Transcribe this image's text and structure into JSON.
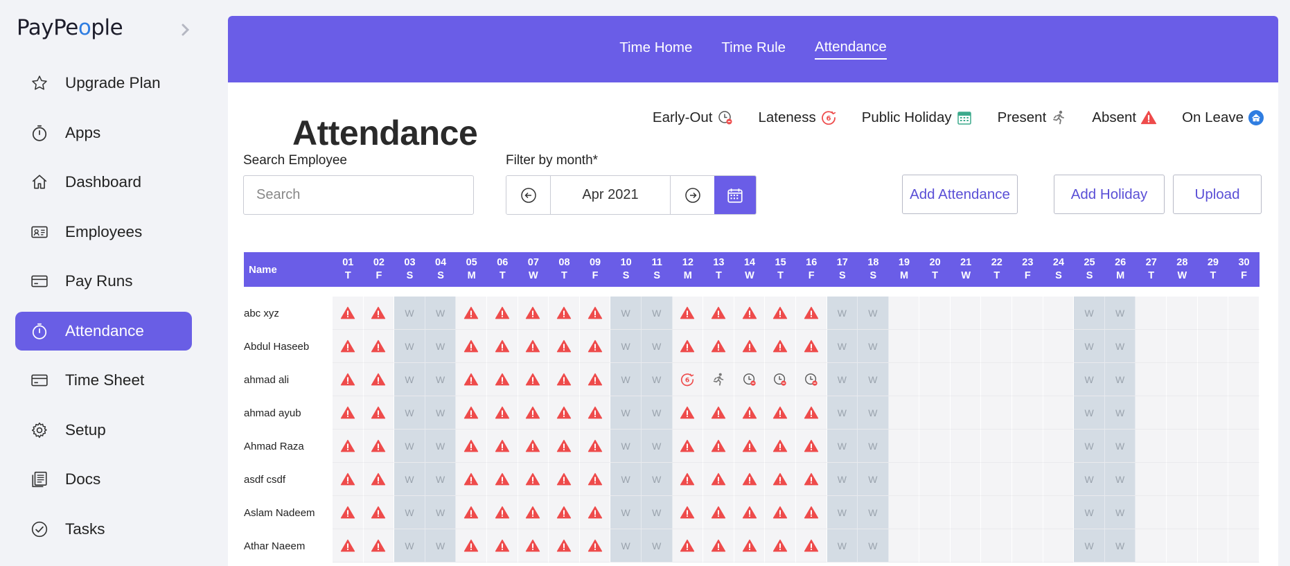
{
  "sidebar": {
    "logo_prefix": "PayPe",
    "logo_o": "o",
    "logo_suffix": "ple",
    "items": [
      {
        "label": "Upgrade Plan",
        "icon": "star-icon"
      },
      {
        "label": "Apps",
        "icon": "stopwatch-icon"
      },
      {
        "label": "Dashboard",
        "icon": "home-icon"
      },
      {
        "label": "Employees",
        "icon": "id-card-icon"
      },
      {
        "label": "Pay Runs",
        "icon": "card-icon"
      },
      {
        "label": "Attendance",
        "icon": "stopwatch-icon",
        "active": true
      },
      {
        "label": "Time Sheet",
        "icon": "card-icon"
      },
      {
        "label": "Setup",
        "icon": "gear-icon"
      },
      {
        "label": "Docs",
        "icon": "docs-icon"
      },
      {
        "label": "Tasks",
        "icon": "check-circle-icon"
      }
    ]
  },
  "topnav": {
    "tabs": [
      {
        "label": "Time Home"
      },
      {
        "label": "Time Rule"
      },
      {
        "label": "Attendance",
        "active": true
      }
    ]
  },
  "page": {
    "title": "Attendance",
    "legend": [
      {
        "label": "Early-Out",
        "icon": "early-out-icon"
      },
      {
        "label": "Lateness",
        "icon": "lateness-icon"
      },
      {
        "label": "Public Holiday",
        "icon": "calendar-icon"
      },
      {
        "label": "Present",
        "icon": "running-icon"
      },
      {
        "label": "Absent",
        "icon": "warning-icon"
      },
      {
        "label": "On Leave",
        "icon": "home-leave-icon"
      }
    ],
    "search_label": "Search Employee",
    "search_placeholder": "Search",
    "filter_label": "Filter by month*",
    "month_value": "Apr 2021",
    "buttons": {
      "add_attendance": "Add Attendance",
      "add_holiday": "Add Holiday",
      "upload": "Upload"
    }
  },
  "table": {
    "name_header": "Name",
    "weekend_mark": "W",
    "days": [
      {
        "d": "01",
        "w": "T"
      },
      {
        "d": "02",
        "w": "F"
      },
      {
        "d": "03",
        "w": "S"
      },
      {
        "d": "04",
        "w": "S"
      },
      {
        "d": "05",
        "w": "M"
      },
      {
        "d": "06",
        "w": "T"
      },
      {
        "d": "07",
        "w": "W"
      },
      {
        "d": "08",
        "w": "T"
      },
      {
        "d": "09",
        "w": "F"
      },
      {
        "d": "10",
        "w": "S"
      },
      {
        "d": "11",
        "w": "S"
      },
      {
        "d": "12",
        "w": "M"
      },
      {
        "d": "13",
        "w": "T"
      },
      {
        "d": "14",
        "w": "W"
      },
      {
        "d": "15",
        "w": "T"
      },
      {
        "d": "16",
        "w": "F"
      },
      {
        "d": "17",
        "w": "S"
      },
      {
        "d": "18",
        "w": "S"
      },
      {
        "d": "19",
        "w": "M"
      },
      {
        "d": "20",
        "w": "T"
      },
      {
        "d": "21",
        "w": "W"
      },
      {
        "d": "22",
        "w": "T"
      },
      {
        "d": "23",
        "w": "F"
      },
      {
        "d": "24",
        "w": "S"
      },
      {
        "d": "25",
        "w": "S"
      },
      {
        "d": "26",
        "w": "M"
      },
      {
        "d": "27",
        "w": "T"
      },
      {
        "d": "28",
        "w": "W"
      },
      {
        "d": "29",
        "w": "T"
      },
      {
        "d": "30",
        "w": "F"
      }
    ],
    "rows": [
      {
        "name": "abc xyz",
        "cells": "AAWWAAAAAWWAAAAAWW------WW-----"
      },
      {
        "name": "Abdul Haseeb",
        "cells": "AAWWAAAAAWWAAAAAWW------WW-----"
      },
      {
        "name": "ahmad ali",
        "cells": "AAWWAAAAAWWLPEEEWW------WW-----"
      },
      {
        "name": "ahmad ayub",
        "cells": "AAWWAAAAAWWAAAAAWW------WW-----"
      },
      {
        "name": "Ahmad Raza",
        "cells": "AAWWAAAAAWWAAAAAWW------WW-----"
      },
      {
        "name": "asdf csdf",
        "cells": "AAWWAAAAAWWAAAAAWW------WW-----"
      },
      {
        "name": "Aslam Nadeem",
        "cells": "AAWWAAAAAWWAAAAAWW------WW-----"
      },
      {
        "name": "Athar Naeem",
        "cells": "AAWWAAAAAWWAAAAAWW------WW-----"
      }
    ]
  },
  "colors": {
    "accent": "#6a5de7",
    "absent": "#ee4b4b",
    "weekend": "#d4dce4"
  }
}
